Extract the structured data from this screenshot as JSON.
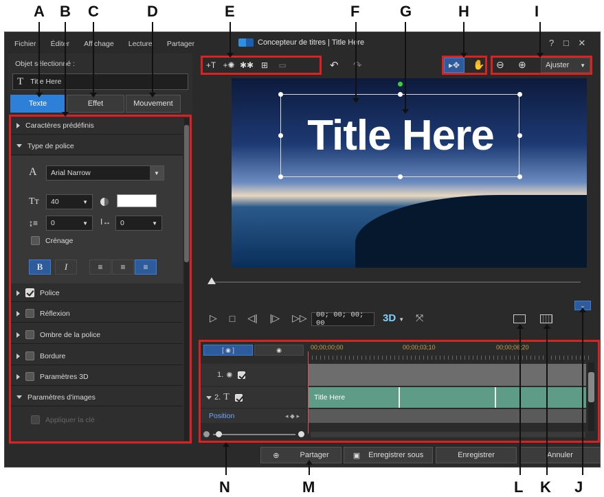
{
  "callouts": [
    "A",
    "B",
    "C",
    "D",
    "E",
    "F",
    "G",
    "H",
    "I",
    "J",
    "K",
    "L",
    "M",
    "N"
  ],
  "window": {
    "title": "Concepteur de titres | Title Here",
    "controls": {
      "help": "?",
      "max": "□",
      "close": "✕"
    }
  },
  "menu": [
    "Fichier",
    "Éditer",
    "Affichage",
    "Lecture",
    "Partager"
  ],
  "left": {
    "selected_label": "Objet sélectionné :",
    "selected_value": "Title Here",
    "tabs": [
      "Texte",
      "Effet",
      "Mouvement"
    ],
    "sections": {
      "presets": "Caractères prédéfinis",
      "font_type": "Type de police",
      "font_name": "Arial Narrow",
      "font_size": "40",
      "line_spacing": "0",
      "char_spacing": "0",
      "kerning": "Crénage",
      "bold": "B",
      "italic": "I",
      "police": "Police",
      "reflexion": "Réflexion",
      "shadow": "Ombre de la police",
      "border": "Bordure",
      "params3d": "Paramètres 3D",
      "image_params": "Paramètres d'images",
      "apply_key": "Appliquer la clé"
    }
  },
  "preview": {
    "title_text": "Title Here",
    "zoom_label": "Ajuster",
    "timecode": "00; 00; 00; 00",
    "three_d": "3D"
  },
  "timeline": {
    "ticks": [
      "00;00;00;00",
      "00;00;03;10",
      "00;00;06;20"
    ],
    "tracks": [
      {
        "num": "1.",
        "label": ""
      },
      {
        "num": "2.",
        "label": "Title Here"
      }
    ],
    "position_label": "Position"
  },
  "buttons": {
    "share": "Partager",
    "save_as": "Enregistrer sous",
    "save": "Enregistrer",
    "cancel": "Annuler"
  },
  "colors": {
    "accent": "#2d7fd8",
    "callout_box": "#e02020",
    "clip": "#5e9c88"
  }
}
